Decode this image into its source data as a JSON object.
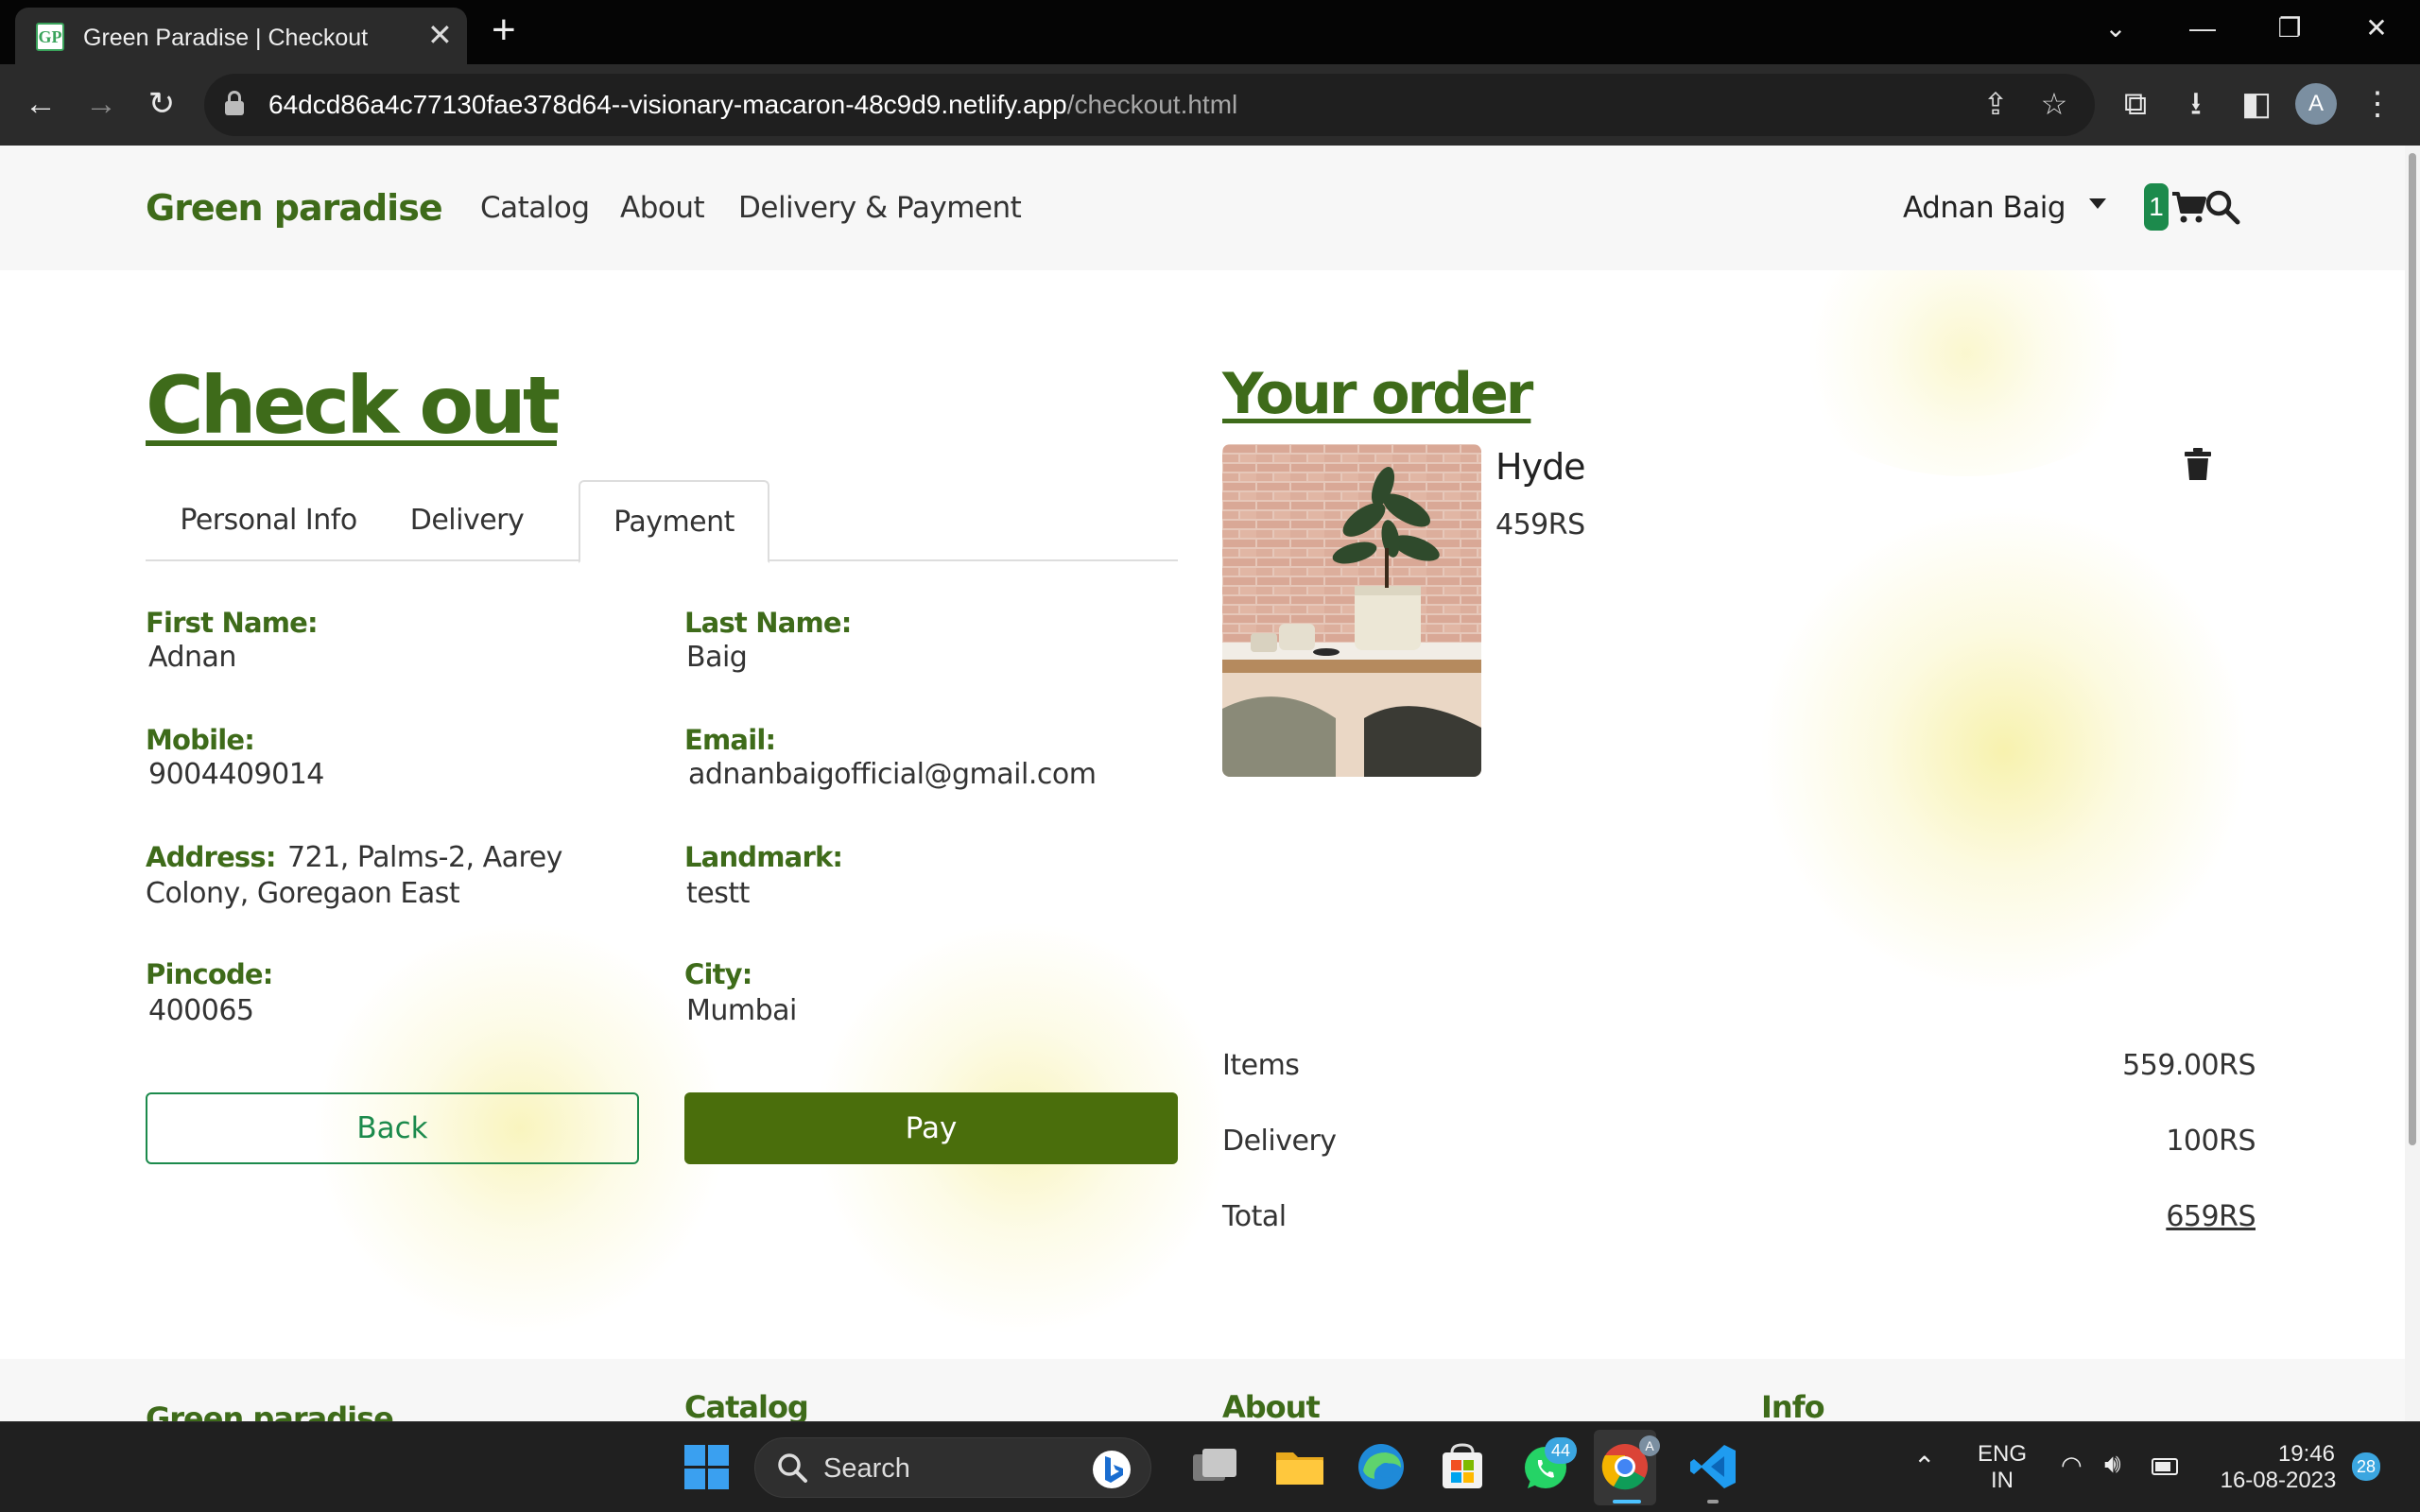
{
  "browser": {
    "tab_title": "Green Paradise | Checkout",
    "tab_favicon_text": "GP",
    "url_host": "64dcd86a4c77130fae378d64--visionary-macaron-48c9d9.netlify.app",
    "url_path": "/checkout.html",
    "profile_initial": "A"
  },
  "header": {
    "logo": "Green paradise",
    "nav": [
      "Catalog",
      "About",
      "Delivery & Payment"
    ],
    "user_name": "Adnan Baig",
    "cart_count": "1"
  },
  "checkout": {
    "title": "Check out",
    "tabs": [
      "Personal Info",
      "Delivery",
      "Payment"
    ],
    "active_tab": "Payment",
    "fields": {
      "first_name": {
        "label": "First Name:",
        "value": "Adnan"
      },
      "last_name": {
        "label": "Last Name:",
        "value": "Baig"
      },
      "mobile": {
        "label": "Mobile:",
        "value": "9004409014"
      },
      "email": {
        "label": "Email:",
        "value": "adnanbaigofficial@gmail.com"
      },
      "address": {
        "label": "Address:",
        "value_line1": "721, Palms-2, Aarey",
        "value_line2": "Colony, Goregaon East"
      },
      "landmark": {
        "label": "Landmark:",
        "value": "testt"
      },
      "pincode": {
        "label": "Pincode:",
        "value": "400065"
      },
      "city": {
        "label": "City:",
        "value": "Mumbai"
      }
    },
    "back_label": "Back",
    "pay_label": "Pay"
  },
  "order": {
    "title": "Your order",
    "item_name": "Hyde",
    "item_price": "459RS",
    "summary": {
      "items_label": "Items",
      "items_value": "559.00RS",
      "delivery_label": "Delivery",
      "delivery_value": "100RS",
      "total_label": "Total",
      "total_value": "659RS"
    }
  },
  "footer": {
    "cols": [
      "Green paradise",
      "Catalog",
      "About",
      "Info"
    ]
  },
  "taskbar": {
    "search_label": "Search",
    "whatsapp_badge": "44",
    "lang_line1": "ENG",
    "lang_line2": "IN",
    "time": "19:46",
    "date": "16-08-2023",
    "notification_count": "28"
  },
  "colors": {
    "brand_green": "#3e6b1a",
    "pay_button": "#4a6e0c",
    "accent_green": "#1c8a4c"
  }
}
